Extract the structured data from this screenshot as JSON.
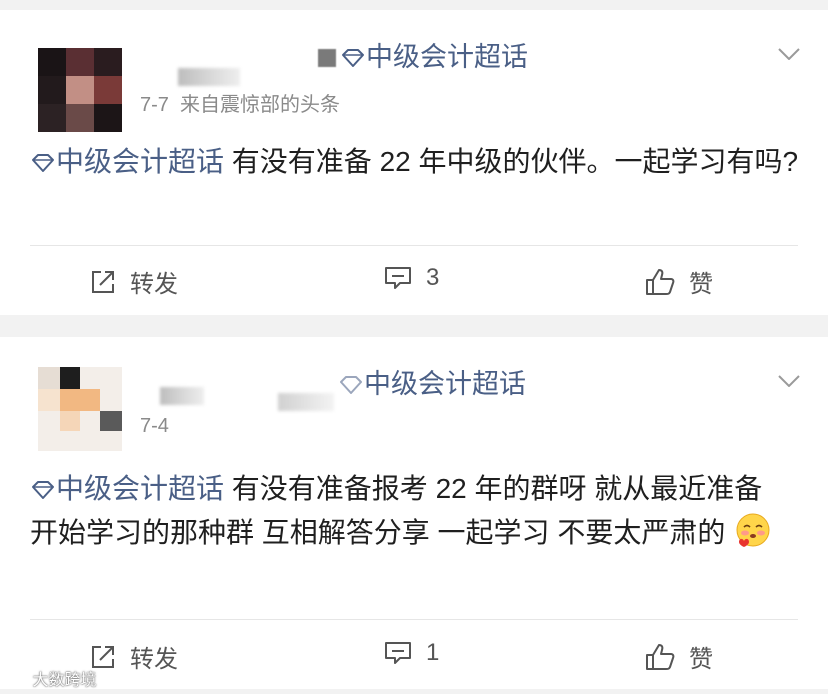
{
  "posts": [
    {
      "topic_header": "中级会计超话",
      "date": "7-7",
      "source": "来自震惊部的头条",
      "topic_tag": "中级会计超话",
      "text": "有没有准备 22 年中级的伙伴。一起学习有吗?",
      "repost_label": "转发",
      "comment_count": "3",
      "like_label": "赞"
    },
    {
      "topic_header": "中级会计超话",
      "date": "7-4",
      "topic_tag": "中级会计超话",
      "text": "有没有准备报考 22 年的群呀  就从最近准备开始学习的那种群  互相解答分享   一起学习 不要太严肃的",
      "repost_label": "转发",
      "comment_count": "1",
      "like_label": "赞"
    }
  ],
  "watermark": "大数跨境",
  "icons": {
    "topic": "diamond-icon",
    "more": "chevron-down-icon",
    "repost": "share-icon",
    "comment": "comment-icon",
    "like": "thumbs-up-icon",
    "emoji": "shy-face-emoji"
  },
  "colors": {
    "topic_link": "#4a5f86",
    "text": "#1f1f1f",
    "meta": "#8a8a8a",
    "background": "#f2f2f2"
  }
}
